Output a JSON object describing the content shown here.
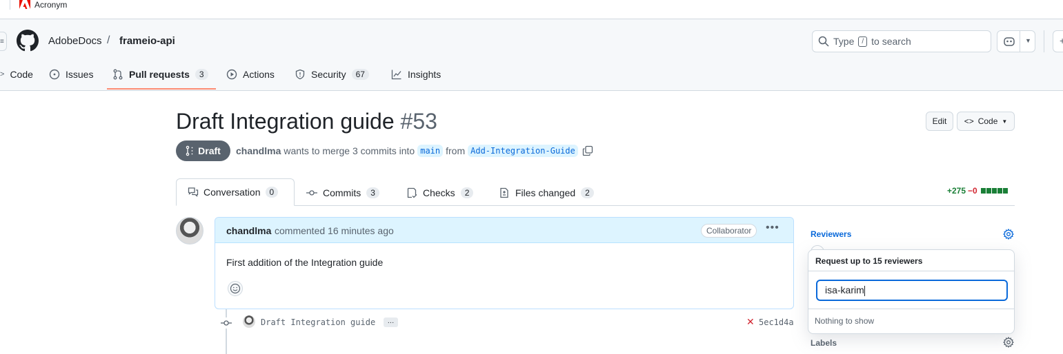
{
  "brand": {
    "name": "Acronym"
  },
  "repo": {
    "owner": "AdobeDocs",
    "separator": "/",
    "name": "frameio-api"
  },
  "search": {
    "prefix": "Type",
    "key": "/",
    "suffix": "to search"
  },
  "nav": {
    "tabs": [
      {
        "label": "Code"
      },
      {
        "label": "Issues"
      },
      {
        "label": "Pull requests",
        "count": "3"
      },
      {
        "label": "Actions"
      },
      {
        "label": "Security",
        "count": "67"
      },
      {
        "label": "Insights"
      }
    ]
  },
  "pr": {
    "title": "Draft Integration guide",
    "number": "#53",
    "state": "Draft",
    "author": "chandlma",
    "merge_text": "wants to merge 3 commits into",
    "base_branch": "main",
    "from_text": "from",
    "head_branch": "Add-Integration-Guide",
    "edit_label": "Edit",
    "code_label": "Code"
  },
  "pr_tabs": [
    {
      "label": "Conversation",
      "count": "0"
    },
    {
      "label": "Commits",
      "count": "3"
    },
    {
      "label": "Checks",
      "count": "2"
    },
    {
      "label": "Files changed",
      "count": "2"
    }
  ],
  "diffstat": {
    "additions": "+275",
    "deletions": "−0"
  },
  "comment": {
    "author": "chandlma",
    "meta": "commented 16 minutes ago",
    "badge": "Collaborator",
    "body": "First addition of the Integration guide"
  },
  "commit": {
    "message": "Draft Integration guide",
    "ellipsis": "…",
    "sha": "5ec1d4a"
  },
  "sidebar": {
    "reviewers_label": "Reviewers",
    "labels_label": "Labels",
    "popup": {
      "title": "Request up to 15 reviewers",
      "input_value": "isa-karim",
      "empty": "Nothing to show"
    }
  },
  "colors": {
    "accent": "#0969da",
    "tab_underline": "#fd8c73",
    "draft_bg": "#59636e",
    "added": "#1a7f37",
    "removed": "#d1242f"
  }
}
